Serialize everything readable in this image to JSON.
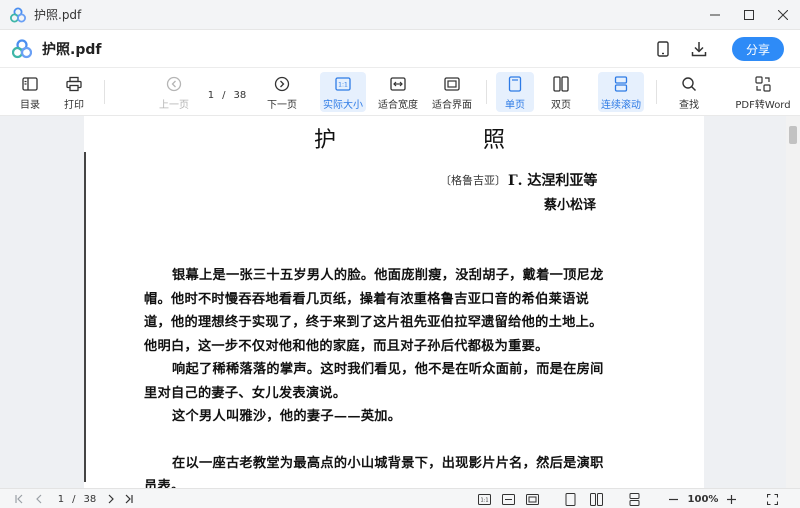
{
  "window": {
    "title": "护照.pdf"
  },
  "header": {
    "doc_name": "护照.pdf",
    "share_label": "分享"
  },
  "toolbar": {
    "toc": "目录",
    "print": "打印",
    "prev_page": "上一页",
    "current_page": "1",
    "page_sep": "/",
    "total_pages": "38",
    "next_page": "下一页",
    "actual_size": "实际大小",
    "fit_width": "适合宽度",
    "fit_page": "适合界面",
    "single_page": "单页",
    "double_page": "双页",
    "continuous_scroll": "连续滚动",
    "find": "查找",
    "pdf_to_word": "PDF转Word"
  },
  "document": {
    "title": "护 照",
    "origin": "〔格鲁吉亚〕",
    "author": "Г. 达涅利亚等",
    "translator": "蔡小松译",
    "paragraphs": [
      "银幕上是一张三十五岁男人的脸。他面庞削瘦，没刮胡子，戴着一顶尼龙帽。他时不时慢吞吞地看看几页纸，操着有浓重格鲁吉亚口音的希伯莱语说道，他的理想终于实现了，终于来到了这片祖先亚伯拉罕遗留给他的土地上。他明白，这一步不仅对他和他的家庭，而且对子孙后代都极为重要。",
      "响起了稀稀落落的掌声。这时我们看见，他不是在听众面前，而是在房间里对自己的妻子、女儿发表演说。",
      "这个男人叫雅沙，他的妻子——英加。",
      "在以一座古老教堂为最高点的小山城背景下，出现影片片名，然后是演职员表。"
    ]
  },
  "bottom": {
    "current_page": "1",
    "page_sep": "/",
    "total_pages": "38",
    "zoom": "100%"
  },
  "colors": {
    "accent": "#2e8bf7",
    "active_bg": "#e6f0fd"
  }
}
